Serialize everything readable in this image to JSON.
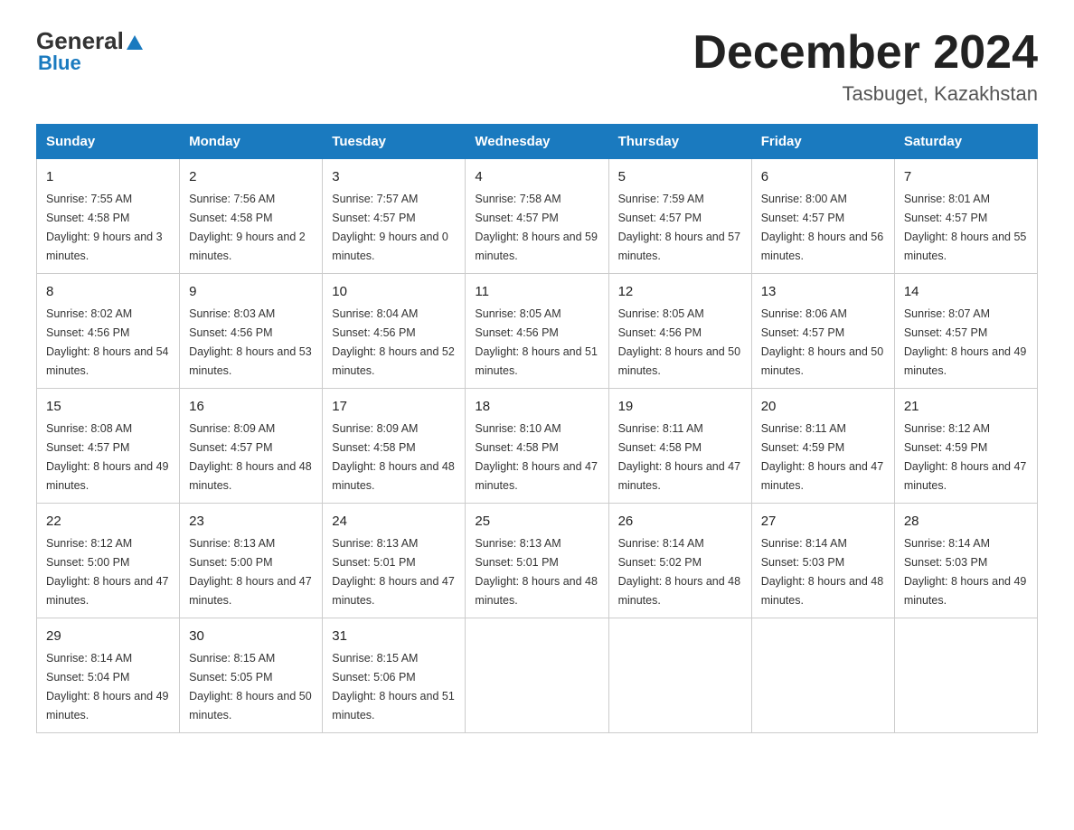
{
  "header": {
    "logo_general": "General",
    "logo_blue": "Blue",
    "month_title": "December 2024",
    "location": "Tasbuget, Kazakhstan"
  },
  "days_of_week": [
    "Sunday",
    "Monday",
    "Tuesday",
    "Wednesday",
    "Thursday",
    "Friday",
    "Saturday"
  ],
  "weeks": [
    [
      {
        "day": "1",
        "sunrise": "Sunrise: 7:55 AM",
        "sunset": "Sunset: 4:58 PM",
        "daylight": "Daylight: 9 hours and 3 minutes."
      },
      {
        "day": "2",
        "sunrise": "Sunrise: 7:56 AM",
        "sunset": "Sunset: 4:58 PM",
        "daylight": "Daylight: 9 hours and 2 minutes."
      },
      {
        "day": "3",
        "sunrise": "Sunrise: 7:57 AM",
        "sunset": "Sunset: 4:57 PM",
        "daylight": "Daylight: 9 hours and 0 minutes."
      },
      {
        "day": "4",
        "sunrise": "Sunrise: 7:58 AM",
        "sunset": "Sunset: 4:57 PM",
        "daylight": "Daylight: 8 hours and 59 minutes."
      },
      {
        "day": "5",
        "sunrise": "Sunrise: 7:59 AM",
        "sunset": "Sunset: 4:57 PM",
        "daylight": "Daylight: 8 hours and 57 minutes."
      },
      {
        "day": "6",
        "sunrise": "Sunrise: 8:00 AM",
        "sunset": "Sunset: 4:57 PM",
        "daylight": "Daylight: 8 hours and 56 minutes."
      },
      {
        "day": "7",
        "sunrise": "Sunrise: 8:01 AM",
        "sunset": "Sunset: 4:57 PM",
        "daylight": "Daylight: 8 hours and 55 minutes."
      }
    ],
    [
      {
        "day": "8",
        "sunrise": "Sunrise: 8:02 AM",
        "sunset": "Sunset: 4:56 PM",
        "daylight": "Daylight: 8 hours and 54 minutes."
      },
      {
        "day": "9",
        "sunrise": "Sunrise: 8:03 AM",
        "sunset": "Sunset: 4:56 PM",
        "daylight": "Daylight: 8 hours and 53 minutes."
      },
      {
        "day": "10",
        "sunrise": "Sunrise: 8:04 AM",
        "sunset": "Sunset: 4:56 PM",
        "daylight": "Daylight: 8 hours and 52 minutes."
      },
      {
        "day": "11",
        "sunrise": "Sunrise: 8:05 AM",
        "sunset": "Sunset: 4:56 PM",
        "daylight": "Daylight: 8 hours and 51 minutes."
      },
      {
        "day": "12",
        "sunrise": "Sunrise: 8:05 AM",
        "sunset": "Sunset: 4:56 PM",
        "daylight": "Daylight: 8 hours and 50 minutes."
      },
      {
        "day": "13",
        "sunrise": "Sunrise: 8:06 AM",
        "sunset": "Sunset: 4:57 PM",
        "daylight": "Daylight: 8 hours and 50 minutes."
      },
      {
        "day": "14",
        "sunrise": "Sunrise: 8:07 AM",
        "sunset": "Sunset: 4:57 PM",
        "daylight": "Daylight: 8 hours and 49 minutes."
      }
    ],
    [
      {
        "day": "15",
        "sunrise": "Sunrise: 8:08 AM",
        "sunset": "Sunset: 4:57 PM",
        "daylight": "Daylight: 8 hours and 49 minutes."
      },
      {
        "day": "16",
        "sunrise": "Sunrise: 8:09 AM",
        "sunset": "Sunset: 4:57 PM",
        "daylight": "Daylight: 8 hours and 48 minutes."
      },
      {
        "day": "17",
        "sunrise": "Sunrise: 8:09 AM",
        "sunset": "Sunset: 4:58 PM",
        "daylight": "Daylight: 8 hours and 48 minutes."
      },
      {
        "day": "18",
        "sunrise": "Sunrise: 8:10 AM",
        "sunset": "Sunset: 4:58 PM",
        "daylight": "Daylight: 8 hours and 47 minutes."
      },
      {
        "day": "19",
        "sunrise": "Sunrise: 8:11 AM",
        "sunset": "Sunset: 4:58 PM",
        "daylight": "Daylight: 8 hours and 47 minutes."
      },
      {
        "day": "20",
        "sunrise": "Sunrise: 8:11 AM",
        "sunset": "Sunset: 4:59 PM",
        "daylight": "Daylight: 8 hours and 47 minutes."
      },
      {
        "day": "21",
        "sunrise": "Sunrise: 8:12 AM",
        "sunset": "Sunset: 4:59 PM",
        "daylight": "Daylight: 8 hours and 47 minutes."
      }
    ],
    [
      {
        "day": "22",
        "sunrise": "Sunrise: 8:12 AM",
        "sunset": "Sunset: 5:00 PM",
        "daylight": "Daylight: 8 hours and 47 minutes."
      },
      {
        "day": "23",
        "sunrise": "Sunrise: 8:13 AM",
        "sunset": "Sunset: 5:00 PM",
        "daylight": "Daylight: 8 hours and 47 minutes."
      },
      {
        "day": "24",
        "sunrise": "Sunrise: 8:13 AM",
        "sunset": "Sunset: 5:01 PM",
        "daylight": "Daylight: 8 hours and 47 minutes."
      },
      {
        "day": "25",
        "sunrise": "Sunrise: 8:13 AM",
        "sunset": "Sunset: 5:01 PM",
        "daylight": "Daylight: 8 hours and 48 minutes."
      },
      {
        "day": "26",
        "sunrise": "Sunrise: 8:14 AM",
        "sunset": "Sunset: 5:02 PM",
        "daylight": "Daylight: 8 hours and 48 minutes."
      },
      {
        "day": "27",
        "sunrise": "Sunrise: 8:14 AM",
        "sunset": "Sunset: 5:03 PM",
        "daylight": "Daylight: 8 hours and 48 minutes."
      },
      {
        "day": "28",
        "sunrise": "Sunrise: 8:14 AM",
        "sunset": "Sunset: 5:03 PM",
        "daylight": "Daylight: 8 hours and 49 minutes."
      }
    ],
    [
      {
        "day": "29",
        "sunrise": "Sunrise: 8:14 AM",
        "sunset": "Sunset: 5:04 PM",
        "daylight": "Daylight: 8 hours and 49 minutes."
      },
      {
        "day": "30",
        "sunrise": "Sunrise: 8:15 AM",
        "sunset": "Sunset: 5:05 PM",
        "daylight": "Daylight: 8 hours and 50 minutes."
      },
      {
        "day": "31",
        "sunrise": "Sunrise: 8:15 AM",
        "sunset": "Sunset: 5:06 PM",
        "daylight": "Daylight: 8 hours and 51 minutes."
      },
      null,
      null,
      null,
      null
    ]
  ],
  "colors": {
    "header_bg": "#1a7abf",
    "header_text": "#ffffff",
    "border": "#cccccc"
  }
}
